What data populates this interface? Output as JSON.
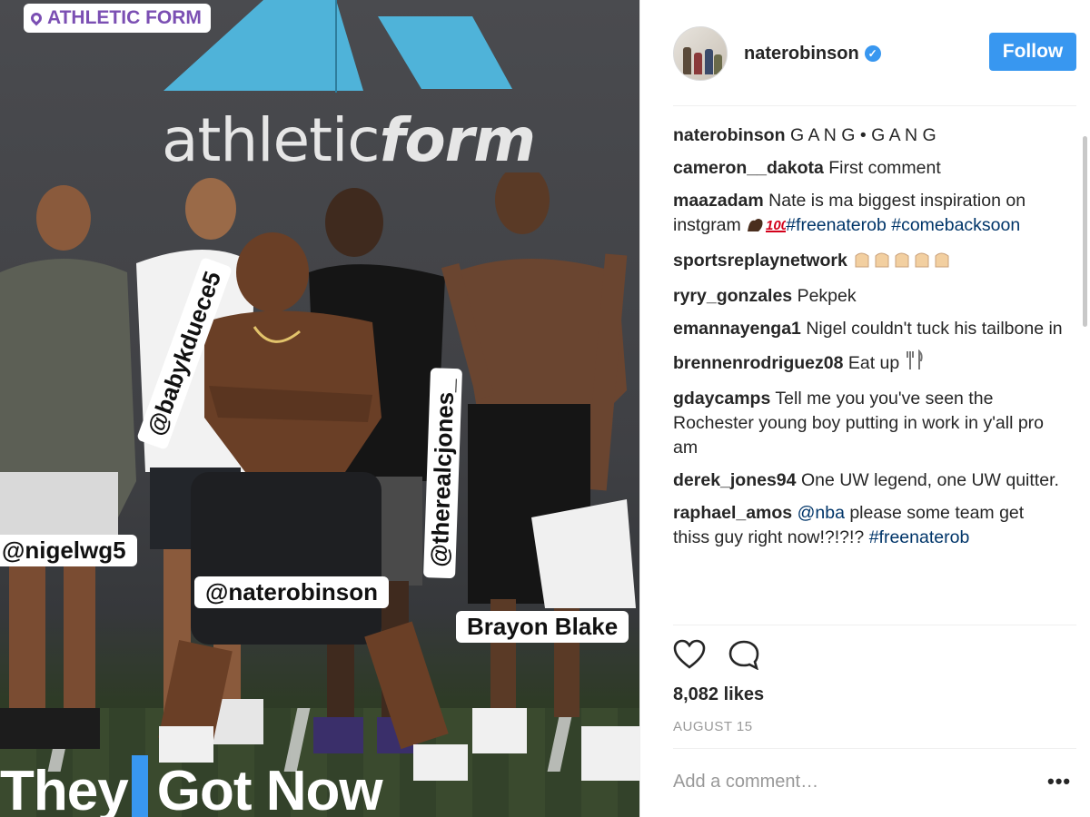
{
  "photo": {
    "location_sticker": "ATHLETIC FORM",
    "brand_text_light": "athletic",
    "brand_text_bold": "form",
    "tags": {
      "babykduece": "@babykduece5",
      "therealcjones": "@therealcjones_",
      "nigelwg": "@nigelwg5",
      "naterobinson": "@naterobinson",
      "brayon": "Brayon Blake"
    },
    "caption_left": "They",
    "caption_right": "Got Now"
  },
  "header": {
    "username": "naterobinson",
    "verified_mark": "✓",
    "follow_label": "Follow"
  },
  "comments": [
    {
      "user": "naterobinson",
      "text": "G A N G • G A N G"
    },
    {
      "user": "cameron__dakota",
      "text": "First comment"
    },
    {
      "user": "maazadam",
      "text": "Nate is ma biggest inspiration on instgram ",
      "link1": "#freenaterob",
      "link2": "#comebacksoon"
    },
    {
      "user": "sportsreplaynetwork",
      "text": ""
    },
    {
      "user": "ryry_gonzales",
      "text": "Pekpek"
    },
    {
      "user": "emannayenga1",
      "text": "Nigel couldn't tuck his tailbone in"
    },
    {
      "user": "brennenrodriguez08",
      "text": "Eat up"
    },
    {
      "user": "gdaycamps",
      "text": "Tell me you you've seen the Rochester young boy putting in work in y'all pro am"
    },
    {
      "user": "derek_jones94",
      "text": "One UW legend, one UW quitter."
    },
    {
      "user": "raphael_amos",
      "mention": "@nba",
      "text": " please some team get thiss guy right now!?!?!? ",
      "link": "#freenaterob"
    }
  ],
  "actions": {
    "like_icon": "heart-icon",
    "comment_icon": "comment-icon"
  },
  "likes": "8,082 likes",
  "date": "AUGUST 15",
  "add_comment_placeholder": "Add a comment…",
  "more_label": "•••",
  "colors": {
    "accent": "#3897f0",
    "link": "#003569",
    "sticker_purple": "#7b4fb3",
    "logo_blue": "#4fb3d9"
  }
}
